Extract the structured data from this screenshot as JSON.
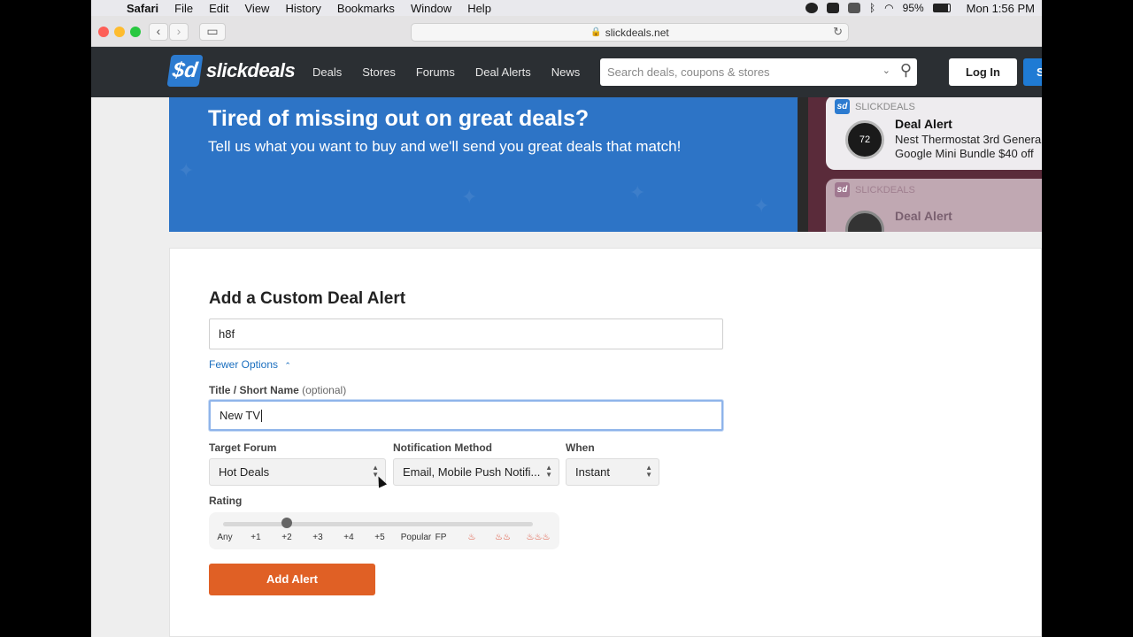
{
  "menubar": {
    "app": "Safari",
    "items": [
      "File",
      "Edit",
      "View",
      "History",
      "Bookmarks",
      "Window",
      "Help"
    ],
    "battery": "95%",
    "clock": "Mon 1:56 PM"
  },
  "browser": {
    "url": "slickdeals.net"
  },
  "site": {
    "logo_mark": "$d",
    "logo_text": "slickdeals",
    "nav": [
      "Deals",
      "Stores",
      "Forums",
      "Deal Alerts",
      "News"
    ],
    "search_placeholder": "Search deals, coupons & stores",
    "login": "Log In",
    "signup": "S"
  },
  "banner": {
    "headline": "Tired of missing out on great deals?",
    "subhead": "Tell us what you want to buy and we'll send you great deals that match!",
    "notifications": [
      {
        "source": "SLICKDEALS",
        "title": "Deal Alert",
        "line1": "Nest Thermostat 3rd Genera",
        "line2": "Google Mini Bundle $40 off",
        "thermo": "72"
      },
      {
        "source": "SLICKDEALS",
        "title": "Deal Alert"
      }
    ]
  },
  "form": {
    "heading": "Add a Custom Deal Alert",
    "keyword": "h8f",
    "fewer_options": "Fewer Options",
    "title_label": "Title / Short Name",
    "title_optional": "(optional)",
    "title_value": "New TV",
    "target_forum_label": "Target Forum",
    "target_forum_value": "Hot Deals",
    "notification_label": "Notification Method",
    "notification_value": "Email, Mobile Push Notifi...",
    "when_label": "When",
    "when_value": "Instant",
    "rating_label": "Rating",
    "rating_ticks": [
      "Any",
      "+1",
      "+2",
      "+3",
      "+4",
      "+5",
      "Popular",
      "FP"
    ],
    "rating_selected": "+2",
    "add_button": "Add Alert"
  }
}
